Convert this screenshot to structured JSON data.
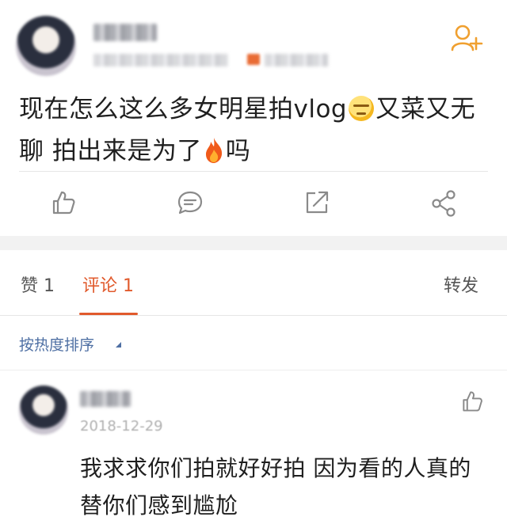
{
  "post": {
    "author_avatar_icon": "user-avatar",
    "follow_icon": "add-user-icon",
    "text_part1": "现在怎么这么多女明星拍vlog",
    "emoji1": "expressionless-face-emoji",
    "text_part2": "又菜又无聊 拍出来是为了",
    "emoji2": "fire-emoji",
    "text_part3": "吗",
    "actions": {
      "like_icon": "thumbs-up-icon",
      "comment_icon": "comment-bubble-icon",
      "share_icon": "repost-icon",
      "more_share_icon": "share-nodes-icon"
    }
  },
  "tabs": {
    "likes_label": "赞 1",
    "comments_label": "评论 1",
    "repost_label": "转发",
    "active": "comments"
  },
  "sort": {
    "label": "按热度排序"
  },
  "comment": {
    "date": "2018-12-29",
    "text": "我求求你们拍就好好拍 因为看的人真的替你们感到尴尬"
  },
  "colors": {
    "accent": "#e15a2c",
    "follow_orange": "#f0a030",
    "link_blue": "#4e6fa3",
    "icon_gray": "#8a8a8a"
  }
}
